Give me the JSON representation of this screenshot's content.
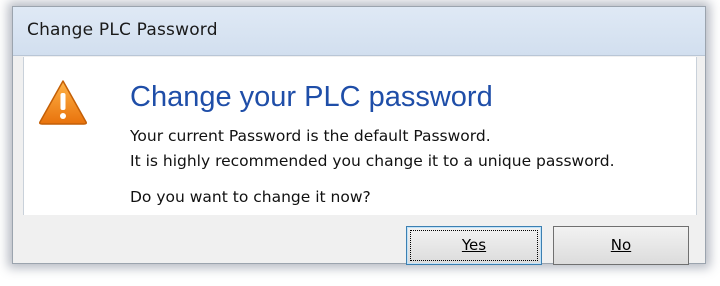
{
  "window": {
    "title": "Change PLC Password"
  },
  "message": {
    "heading": "Change your PLC password",
    "line1": "Your current Password is the default Password.",
    "line2": "It is highly recommended you change it to a unique password.",
    "question": "Do you want to change it now?"
  },
  "buttons": {
    "yes_label": "Yes",
    "no_label": "No"
  },
  "icons": {
    "warning": "warning-icon"
  },
  "colors": {
    "heading": "#1f4ea8",
    "warning_fill": "#f0901e"
  }
}
